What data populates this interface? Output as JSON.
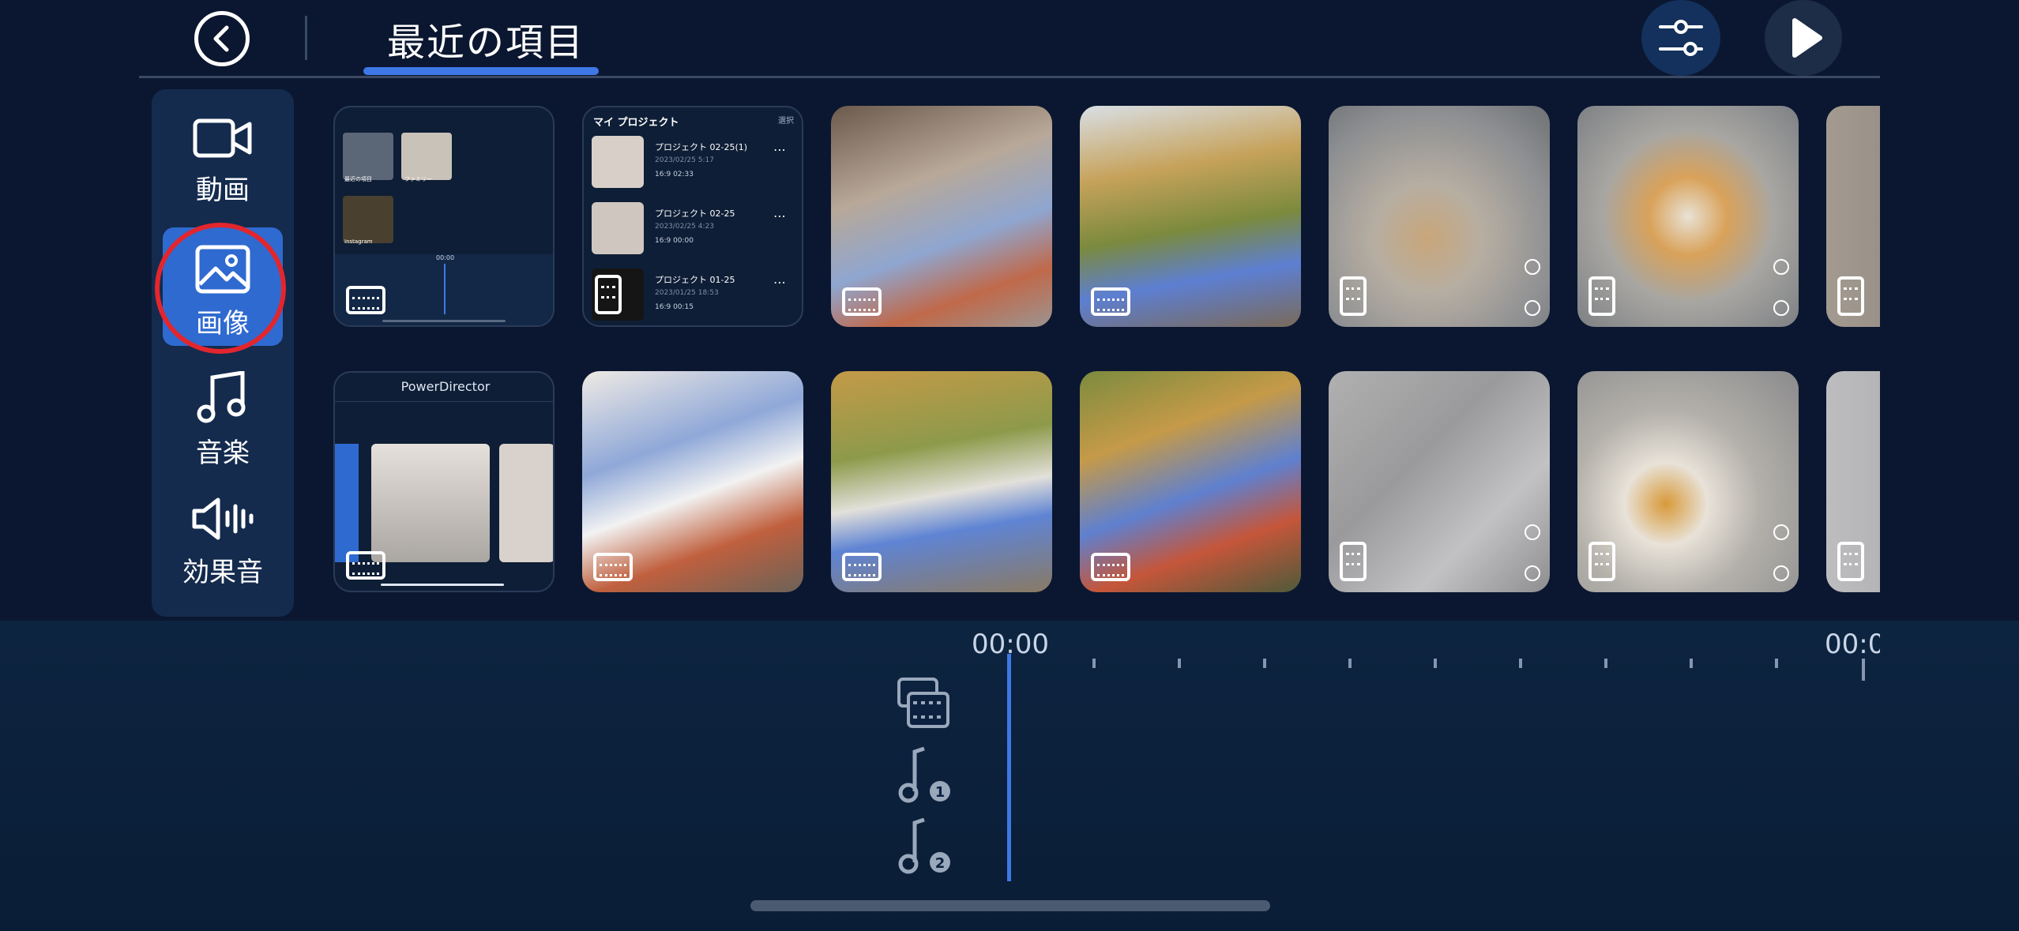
{
  "header": {
    "title": "最近の項目",
    "back_icon": "chevron-left-icon",
    "settings_icon": "sliders-icon",
    "play_icon": "play-icon",
    "accent_color": "#3e78e6"
  },
  "sidebar": {
    "items": [
      {
        "label": "動画",
        "icon": "video-camera-icon"
      },
      {
        "label": "画像",
        "icon": "image-icon",
        "selected": true
      },
      {
        "label": "音楽",
        "icon": "music-note-icon"
      },
      {
        "label": "効果音",
        "icon": "speaker-icon"
      }
    ]
  },
  "grid": {
    "row1": {
      "thumb1_labels": [
        "最近の項目",
        "ファミリー",
        "Instagram"
      ],
      "thumb1_time": "00:00",
      "thumb2_title": "マイ プロジェクト",
      "thumb2_select": "選択",
      "projects": [
        {
          "name": "プロジェクト 02-25(1)",
          "date": "2023/02/25  5:17",
          "meta": "16:9   02:33"
        },
        {
          "name": "プロジェクト 02-25",
          "date": "2023/02/25  4:23",
          "meta": "16:9   00:00"
        },
        {
          "name": "プロジェクト 01-25",
          "date": "2023/01/25  18:53",
          "meta": "16:9   00:15"
        }
      ]
    },
    "row2": {
      "thumb1_title": "PowerDirector"
    }
  },
  "timeline": {
    "start_time": "00:00",
    "end_time_partial": "00:0",
    "tracks": [
      "video-track-icon",
      "music-track-1-icon",
      "music-track-2-icon"
    ],
    "track_numbers": [
      "1",
      "2"
    ]
  }
}
